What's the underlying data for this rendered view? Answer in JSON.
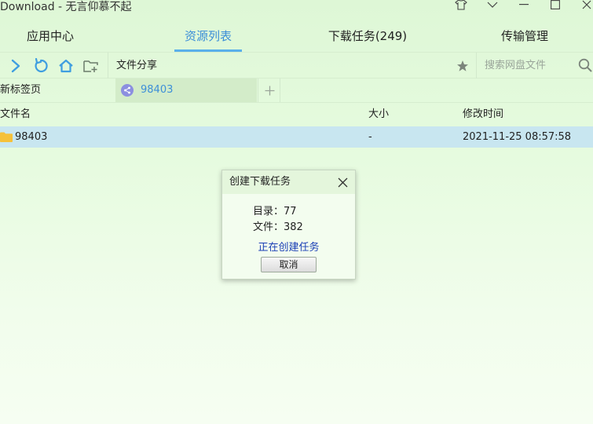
{
  "window": {
    "title": "Download - 无言仰慕不起"
  },
  "main_tabs": [
    {
      "label": "应用中心"
    },
    {
      "label": "资源列表"
    },
    {
      "label": "下载任务(249)"
    },
    {
      "label": "传输管理"
    }
  ],
  "main_tabs_active": "资源列表",
  "toolbar": {
    "path_label": "文件分享",
    "search_placeholder": "搜索网盘文件"
  },
  "subtabs": {
    "new_tab_label": "新标签页",
    "active_tab_label": "98403"
  },
  "table": {
    "columns": [
      "文件名",
      "大小",
      "修改时间"
    ],
    "rows": [
      {
        "name": "98403",
        "size": "-",
        "modified": "2021-11-25 08:57:58"
      }
    ]
  },
  "dialog": {
    "title": "创建下载任务",
    "directories": "目录：77",
    "files": "文件：382",
    "status": "正在创建任务",
    "cancel_label": "取消"
  },
  "colors": {
    "accent": "#3d8fd8",
    "icon_blue": "#3f9ee0",
    "status_text": "#1c3fb6",
    "folder": "#f5c13a",
    "selected_row": "#c8e6f0"
  }
}
